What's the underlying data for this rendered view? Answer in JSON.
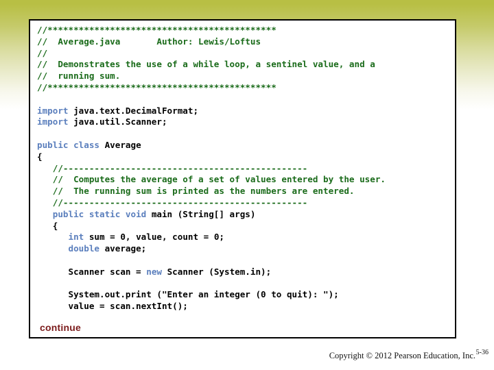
{
  "slide": {
    "background_top_color": "#b8bf44",
    "background_bottom_color": "#ffffff"
  },
  "code_box": {
    "border_color": "#000000",
    "background_color": "#ffffff",
    "comment_color": "#1a6b1a",
    "keyword_color": "#5b7fbd",
    "plain_color": "#000000",
    "lines": [
      "//********************************************",
      "//  Average.java       Author: Lewis/Loftus",
      "//",
      "//  Demonstrates the use of a while loop, a sentinel value, and a",
      "//  running sum.",
      "//********************************************",
      "",
      "import java.text.DecimalFormat;",
      "import java.util.Scanner;",
      "",
      "public class Average",
      "{",
      "   //-----------------------------------------------",
      "   //  Computes the average of a set of values entered by the user.",
      "   //  The running sum is printed as the numbers are entered.",
      "   //-----------------------------------------------",
      "   public static void main (String[] args)",
      "   {",
      "      int sum = 0, value, count = 0;",
      "      double average;",
      "",
      "      Scanner scan = new Scanner (System.in);",
      "",
      "      System.out.print (\"Enter an integer (0 to quit): \");",
      "      value = scan.nextInt();"
    ],
    "line_tokens": [
      [
        {
          "t": "//********************************************",
          "c": "cmt"
        }
      ],
      [
        {
          "t": "//  Average.java       Author: Lewis/Loftus",
          "c": "cmt"
        }
      ],
      [
        {
          "t": "//",
          "c": "cmt"
        }
      ],
      [
        {
          "t": "//  Demonstrates the use of a while loop, a sentinel value, and a",
          "c": "cmt"
        }
      ],
      [
        {
          "t": "//  running sum.",
          "c": "cmt"
        }
      ],
      [
        {
          "t": "//********************************************",
          "c": "cmt"
        }
      ],
      [
        {
          "t": "",
          "c": "pln"
        }
      ],
      [
        {
          "t": "import ",
          "c": "kw"
        },
        {
          "t": "java.text.DecimalFormat;",
          "c": "pln"
        }
      ],
      [
        {
          "t": "import ",
          "c": "kw"
        },
        {
          "t": "java.util.Scanner;",
          "c": "pln"
        }
      ],
      [
        {
          "t": "",
          "c": "pln"
        }
      ],
      [
        {
          "t": "public class ",
          "c": "kw"
        },
        {
          "t": "Average",
          "c": "pln"
        }
      ],
      [
        {
          "t": "{",
          "c": "pln"
        }
      ],
      [
        {
          "t": "   //-----------------------------------------------",
          "c": "cmt"
        }
      ],
      [
        {
          "t": "   //  Computes the average of a set of values entered by the user.",
          "c": "cmt"
        }
      ],
      [
        {
          "t": "   //  The running sum is printed as the numbers are entered.",
          "c": "cmt"
        }
      ],
      [
        {
          "t": "   //-----------------------------------------------",
          "c": "cmt"
        }
      ],
      [
        {
          "t": "   ",
          "c": "pln"
        },
        {
          "t": "public static void ",
          "c": "kw"
        },
        {
          "t": "main (String[] args)",
          "c": "pln"
        }
      ],
      [
        {
          "t": "   {",
          "c": "pln"
        }
      ],
      [
        {
          "t": "      ",
          "c": "pln"
        },
        {
          "t": "int ",
          "c": "kw"
        },
        {
          "t": "sum = 0, value, count = 0;",
          "c": "pln"
        }
      ],
      [
        {
          "t": "      ",
          "c": "pln"
        },
        {
          "t": "double ",
          "c": "kw"
        },
        {
          "t": "average;",
          "c": "pln"
        }
      ],
      [
        {
          "t": "",
          "c": "pln"
        }
      ],
      [
        {
          "t": "      Scanner scan = ",
          "c": "pln"
        },
        {
          "t": "new ",
          "c": "kw"
        },
        {
          "t": "Scanner (System.in);",
          "c": "pln"
        }
      ],
      [
        {
          "t": "",
          "c": "pln"
        }
      ],
      [
        {
          "t": "      System.out.print (\"Enter an integer (0 to quit): \");",
          "c": "pln"
        }
      ],
      [
        {
          "t": "      value = scan.nextInt();",
          "c": "pln"
        }
      ]
    ]
  },
  "continue_label": {
    "text": "continue",
    "color": "#7b1b1b"
  },
  "footer": {
    "copyright": "Copyright © 2012 Pearson Education, Inc.",
    "slide_number": "5-36"
  }
}
